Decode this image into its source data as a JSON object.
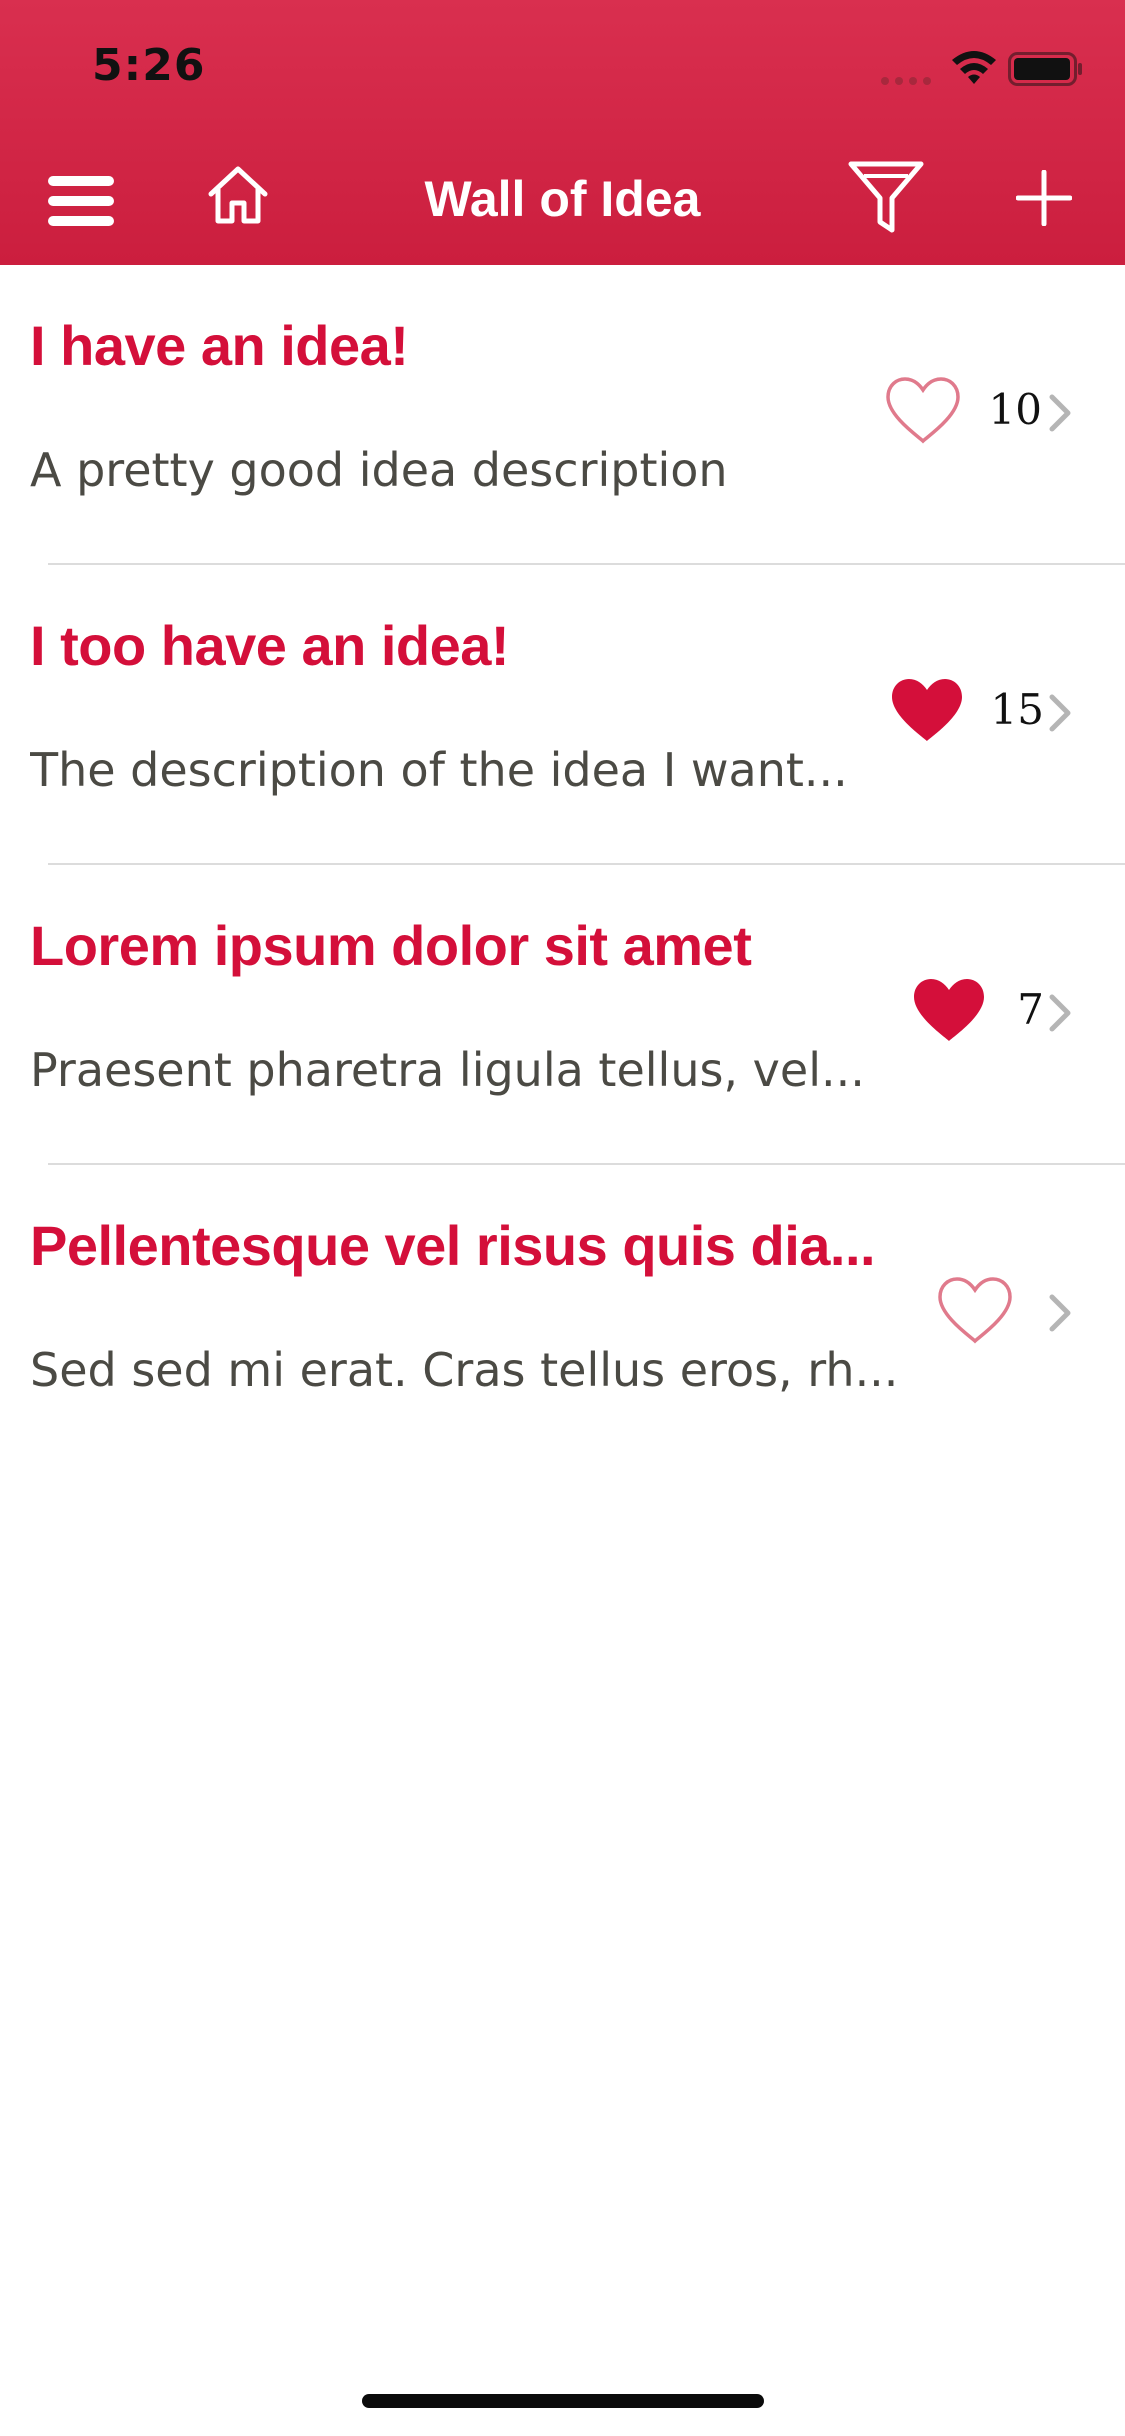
{
  "status_bar": {
    "time": "5:26"
  },
  "nav": {
    "title": "Wall of Idea"
  },
  "colors": {
    "brand_red": "#d40f3a",
    "header_red": "#d22a48",
    "description_gray": "#4b4a44"
  },
  "ideas": [
    {
      "title": "I have an idea!",
      "description": "A pretty good idea description",
      "likes": "10",
      "liked": false
    },
    {
      "title": "I too have an idea!",
      "description": "The description of the idea I want...",
      "likes": "15",
      "liked": true
    },
    {
      "title": "Lorem ipsum dolor sit amet",
      "description": "Praesent pharetra ligula tellus, vel...",
      "likes": "7",
      "liked": true
    },
    {
      "title": "Pellentesque vel risus quis dia...",
      "description": "Sed sed mi erat. Cras tellus eros, rh...",
      "likes": "",
      "liked": false
    }
  ]
}
